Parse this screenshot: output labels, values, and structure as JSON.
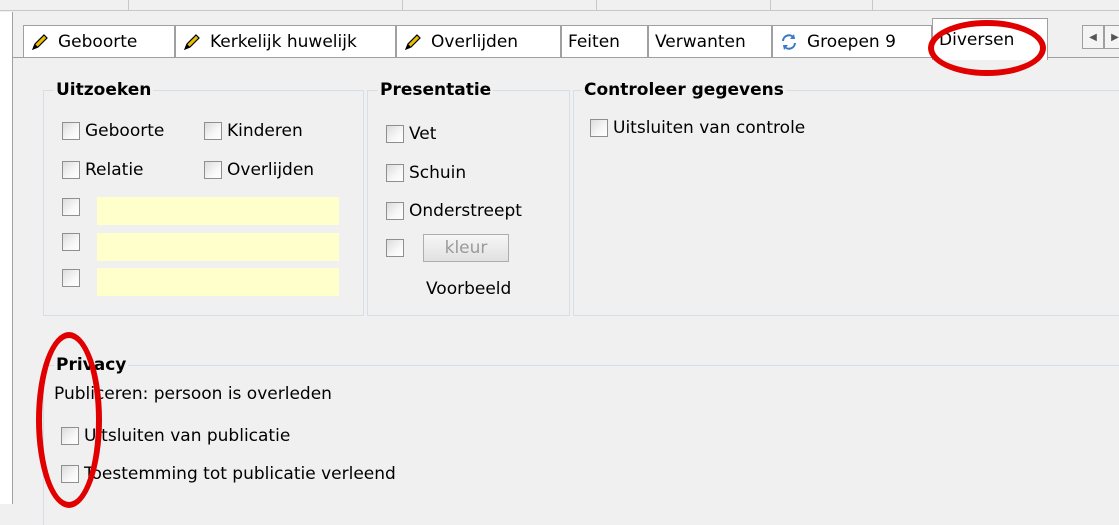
{
  "tabs": [
    {
      "label": "Geboorte",
      "icon": "pencil-icon"
    },
    {
      "label": "Kerkelijk huwelijk",
      "icon": "pencil-icon"
    },
    {
      "label": "Overlijden",
      "icon": "pencil-icon"
    },
    {
      "label": "Feiten",
      "icon": null
    },
    {
      "label": "Verwanten",
      "icon": null
    },
    {
      "label": "Groepen 9",
      "icon": "sync-arrows-icon"
    },
    {
      "label": "Diversen",
      "icon": null,
      "active": true
    }
  ],
  "uitzoeken": {
    "legend": "Uitzoeken",
    "geboorte": "Geboorte",
    "kinderen": "Kinderen",
    "relatie": "Relatie",
    "overlijden": "Overlijden"
  },
  "presentatie": {
    "legend": "Presentatie",
    "vet": "Vet",
    "schuin": "Schuin",
    "onderstreept": "Onderstreept",
    "kleur_button": "kleur",
    "voorbeeld": "Voorbeeld"
  },
  "controleer": {
    "legend": "Controleer gegevens",
    "uitsluiten": "Uitsluiten van controle"
  },
  "privacy": {
    "legend": "Privacy",
    "status": "Publiceren: persoon is overleden",
    "uitsluiten": "Uitsluiten van publicatie",
    "toestemming": "Toestemming tot publicatie verleend"
  },
  "colors": {
    "annotation": "#e00000",
    "input_fill": "#ffffcc"
  }
}
